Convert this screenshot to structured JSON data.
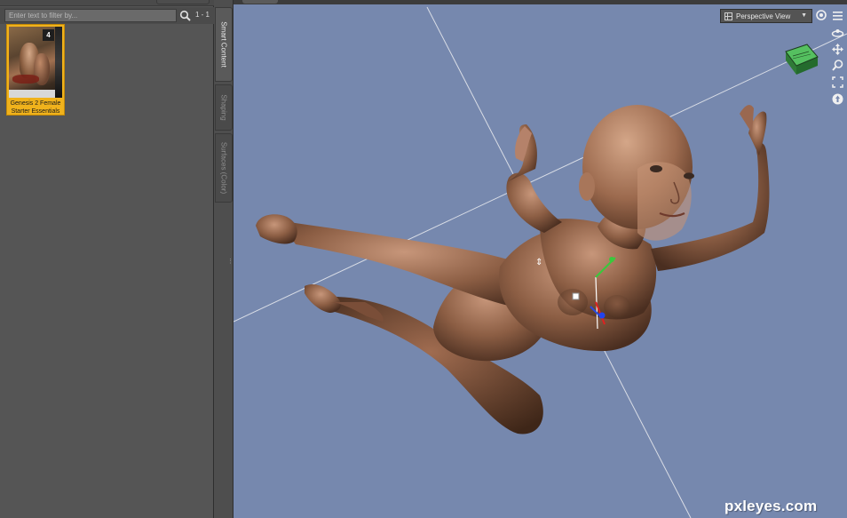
{
  "library": {
    "filter_placeholder": "Enter text to filter by...",
    "result_count": "1 - 1",
    "products": [
      {
        "name": "Genesis 2 Female Starter Essentials",
        "badge": "4"
      }
    ]
  },
  "side_tabs": [
    {
      "label": "Smart Content",
      "active": true
    },
    {
      "label": "Shaping",
      "active": false
    },
    {
      "label": "Surfaces (Color)",
      "active": false
    }
  ],
  "viewport": {
    "view_mode": "Perspective View",
    "background_color": "#7688ae",
    "tools": [
      "camera-icon",
      "orbit-icon",
      "pan-icon",
      "zoom-icon",
      "frame-icon",
      "reset-icon",
      "menu-icon"
    ]
  },
  "watermark": "pxleyes.com",
  "colors": {
    "panel": "#555555",
    "selected_tile": "#f0b21c",
    "nav_cube": "#3e9a45"
  }
}
